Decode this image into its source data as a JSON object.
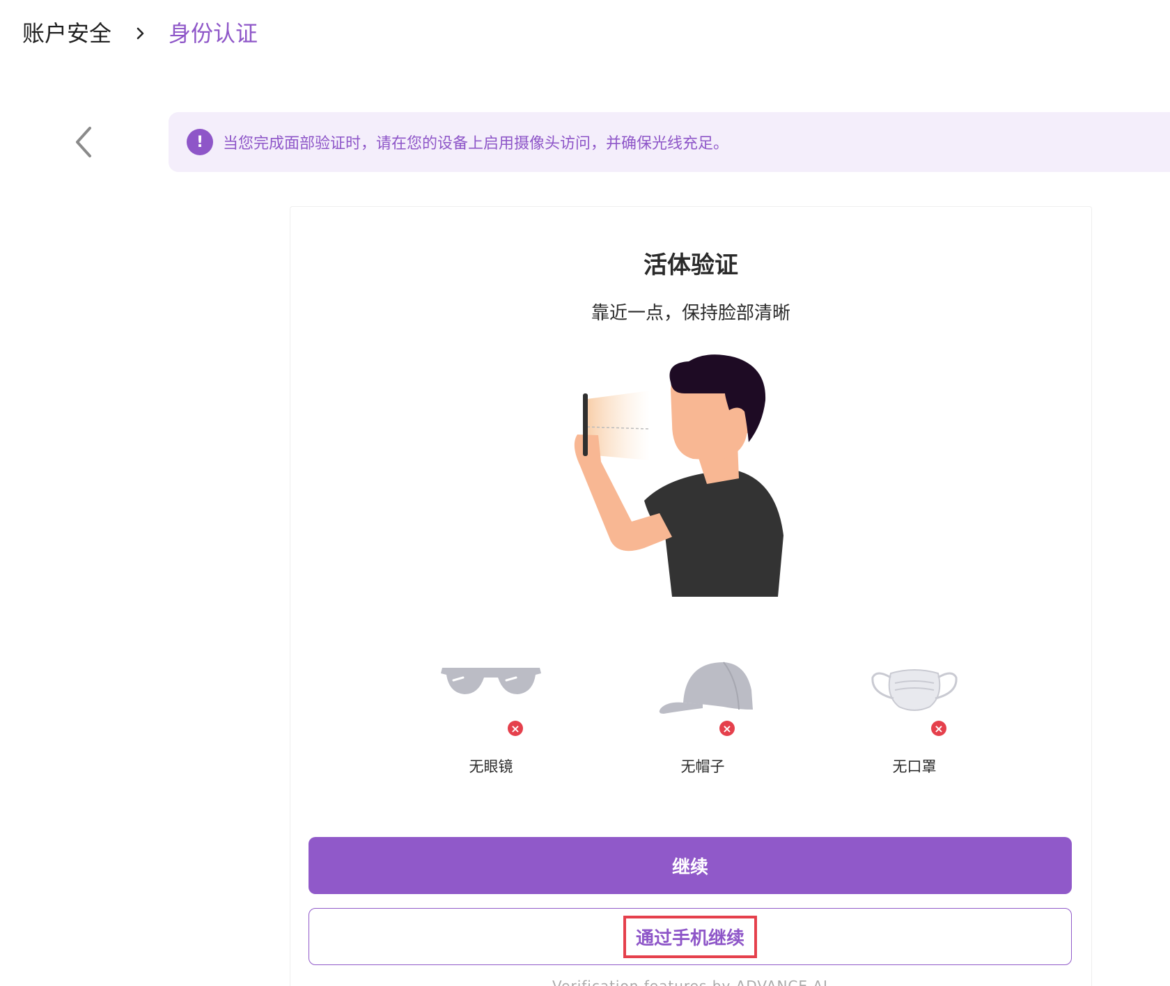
{
  "breadcrumb": {
    "parent": "账户安全",
    "current": "身份认证"
  },
  "notice": {
    "text": "当您完成面部验证时，请在您的设备上启用摄像头访问，并确保光线充足。",
    "icon": "exclamation-icon"
  },
  "card": {
    "title": "活体验证",
    "subtitle": "靠近一点，保持脸部清晰",
    "requirements": [
      {
        "label": "无眼镜",
        "icon": "sunglasses-icon"
      },
      {
        "label": "无帽子",
        "icon": "cap-icon"
      },
      {
        "label": "无口罩",
        "icon": "mask-icon"
      }
    ],
    "continue_label": "继续",
    "continue_phone_label": "通过手机继续",
    "footer": "Verification features by ADVANCE AI"
  },
  "colors": {
    "accent": "#9059c9",
    "notice_bg": "#f4eefb",
    "error": "#e5404c"
  }
}
